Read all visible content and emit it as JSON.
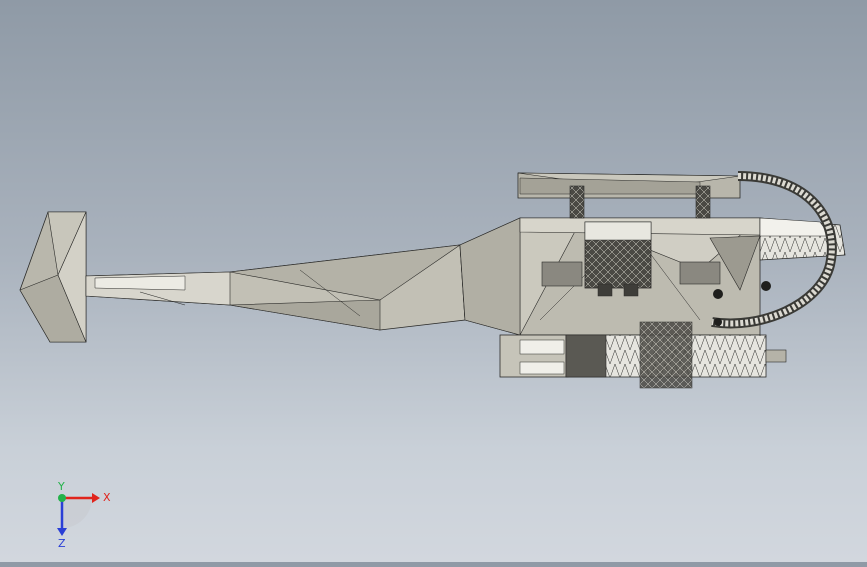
{
  "viewport": {
    "view_name": "helicopter-mesh-model",
    "background_top": "#8f9aa6",
    "background_bottom": "#d2d7de"
  },
  "model": {
    "fill_light": "#c8c6bb",
    "fill_mid": "#a9a79c",
    "fill_dark": "#5f5e58",
    "edge_color": "#2a2a28"
  },
  "triad": {
    "x_label": "X",
    "y_label": "Y",
    "z_label": "Z",
    "x_color": "#e0241c",
    "y_color": "#23b24a",
    "z_color": "#2a3fd6"
  }
}
